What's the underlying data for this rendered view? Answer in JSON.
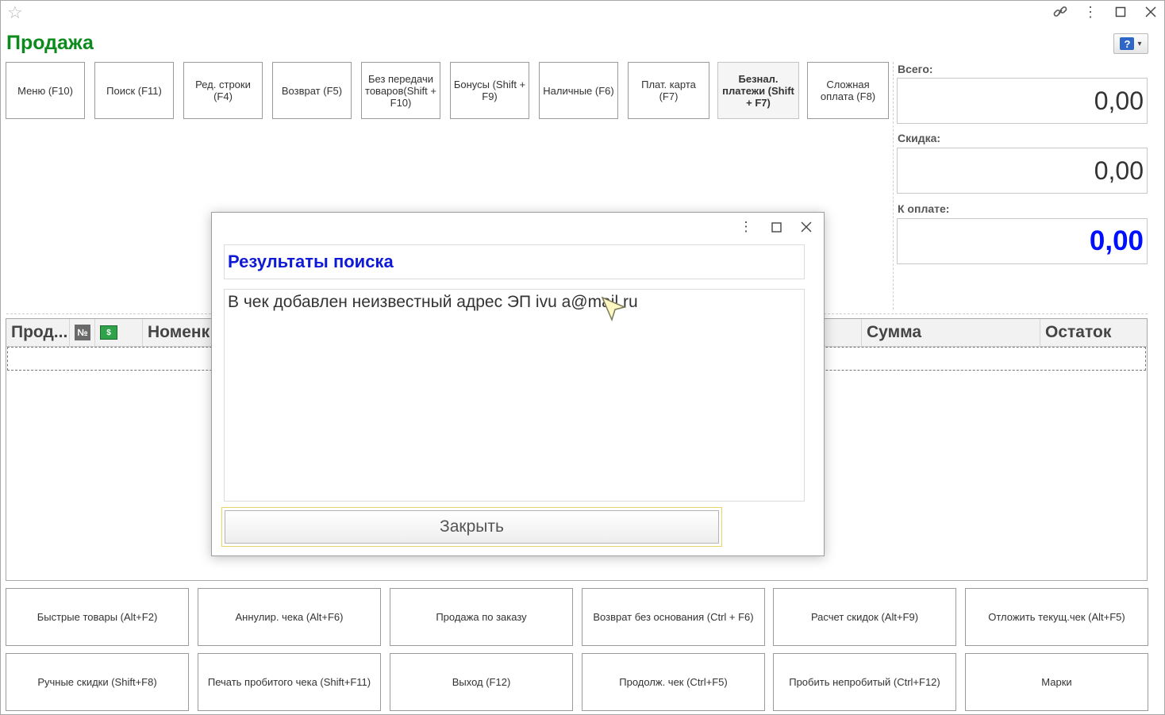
{
  "window": {
    "title": "Продажа"
  },
  "toolbar": [
    "Меню (F10)",
    "Поиск (F11)",
    "Ред. строки (F4)",
    "Возврат (F5)",
    "Без передачи товаров(Shift + F10)",
    "Бонусы (Shift + F9)",
    "Наличные (F6)",
    "Плат. карта (F7)",
    "Безнал. платежи (Shift + F7)",
    "Сложная оплата (F8)"
  ],
  "totals": {
    "total_label": "Всего:",
    "total_value": "0,00",
    "discount_label": "Скидка:",
    "discount_value": "0,00",
    "topay_label": "К оплате:",
    "topay_value": "0,00",
    "topay_color": "#0010ff"
  },
  "table": {
    "columns": [
      "Прод...",
      "№",
      "",
      "Номенк",
      "Сумма",
      "Остаток"
    ]
  },
  "bottom_buttons": [
    "Быстрые товары (Alt+F2)",
    "Аннулир. чека (Alt+F6)",
    "Продажа по заказу",
    "Возврат без основания (Ctrl + F6)",
    "Расчет скидок (Alt+F9)",
    "Отложить текущ.чек (Alt+F5)",
    "Ручные скидки (Shift+F8)",
    "Печать пробитого чека (Shift+F11)",
    "Выход (F12)",
    "Продолж. чек (Ctrl+F5)",
    "Пробить непробитый (Ctrl+F12)",
    "Марки"
  ],
  "dialog": {
    "title": "Результаты поиска",
    "message": "В чек добавлен неизвестный адрес ЭП ivu    a@mail.ru",
    "close_label": "Закрыть",
    "title_color": "#0f19d6"
  },
  "icons": [
    "star-icon",
    "link-icon",
    "more-vertical-icon",
    "maximize-icon",
    "close-icon",
    "help-icon",
    "number-icon",
    "cash-icon",
    "mouse-cursor-icon"
  ],
  "brand_color": "#0d8a1e"
}
